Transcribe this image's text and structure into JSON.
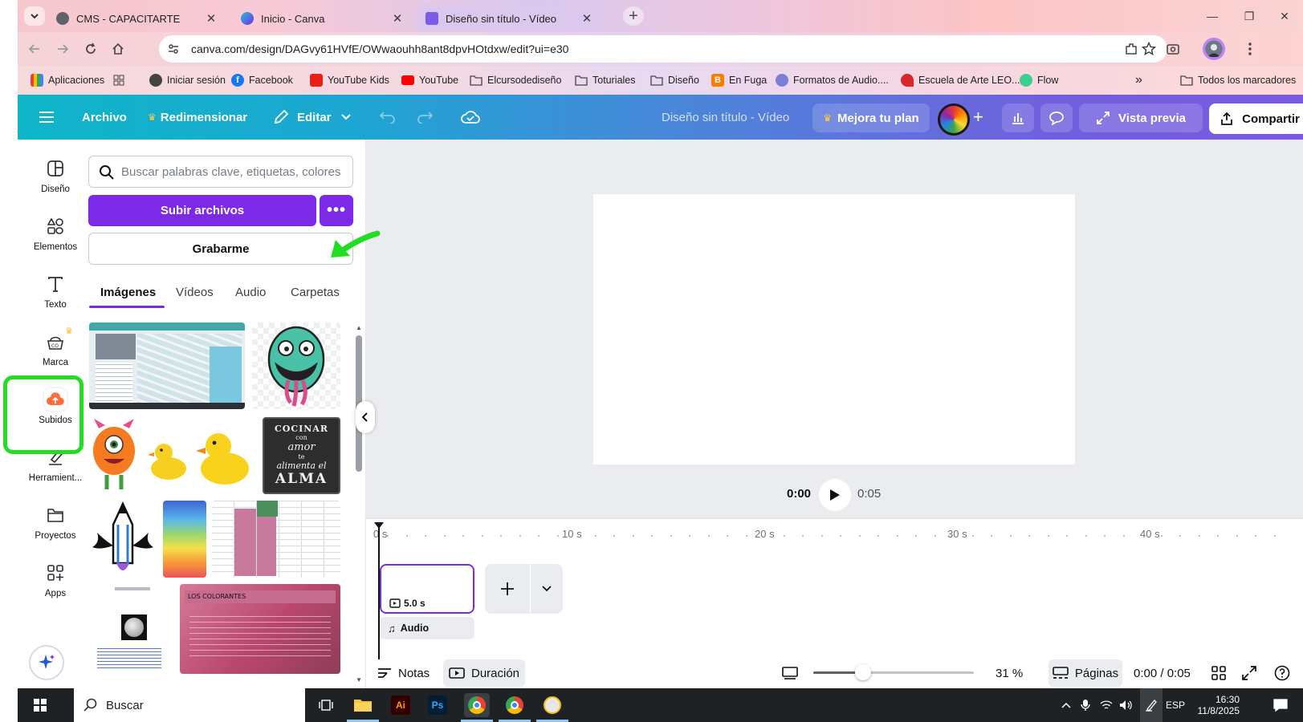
{
  "browser": {
    "tabs": [
      {
        "title": "CMS - CAPACITARTE",
        "close": "✕"
      },
      {
        "title": "Inicio - Canva",
        "close": "✕"
      },
      {
        "title": "Diseño sin título - Vídeo",
        "close": "✕"
      }
    ],
    "new_tab": "+",
    "url": "canva.com/design/DAGvy61HVfE/OWwaouhh8ant8dpvHOtdxw/edit?ui=e30",
    "bookmarks": [
      {
        "label": "Aplicaciones",
        "icon": "apps-grid-icon"
      },
      {
        "label": "",
        "icon": "grid-icon"
      },
      {
        "label": "Iniciar sesión",
        "icon": "globe-icon"
      },
      {
        "label": "Facebook",
        "icon": "facebook-icon"
      },
      {
        "label": "YouTube Kids",
        "icon": "youtube-kids-icon"
      },
      {
        "label": "YouTube",
        "icon": "youtube-icon"
      },
      {
        "label": "Elcursodediseño",
        "icon": "folder-icon"
      },
      {
        "label": "Toturiales",
        "icon": "folder-icon"
      },
      {
        "label": "Diseño",
        "icon": "folder-icon"
      },
      {
        "label": "En Fuga",
        "icon": "blogger-icon"
      },
      {
        "label": "Formatos de Audio....",
        "icon": "globe-icon"
      },
      {
        "label": "Escuela de Arte LEO...",
        "icon": "leo-icon"
      },
      {
        "label": "Flow",
        "icon": "flow-icon"
      }
    ],
    "bookmarks_overflow": "»",
    "all_bookmarks": "Todos los marcadores"
  },
  "canva": {
    "menu_file": "Archivo",
    "menu_resize": "Redimensionar",
    "menu_edit": "Editar",
    "doc_title": "Diseño sin título - Vídeo",
    "upgrade": "Mejora tu plan",
    "preview": "Vista previa",
    "share": "Compartir",
    "brand_color": "#7d2ae8"
  },
  "rail": [
    {
      "label": "Diseño",
      "icon": "layout-icon"
    },
    {
      "label": "Elementos",
      "icon": "elements-icon"
    },
    {
      "label": "Texto",
      "icon": "text-icon"
    },
    {
      "label": "Marca",
      "icon": "brand-icon"
    },
    {
      "label": "Subidos",
      "icon": "upload-cloud-icon"
    },
    {
      "label": "Herramient...",
      "icon": "draw-tool-icon"
    },
    {
      "label": "Proyectos",
      "icon": "folder-icon"
    },
    {
      "label": "Apps",
      "icon": "apps-icon"
    }
  ],
  "panel": {
    "search_placeholder": "Buscar palabras clave, etiquetas, colores",
    "upload_button": "Subir archivos",
    "upload_more": "•••",
    "record_button": "Grabarme",
    "tabs": [
      "Imágenes",
      "Vídeos",
      "Audio",
      "Carpetas"
    ],
    "thumb_text": {
      "chalk_line1": "COCINAR",
      "chalk_line2": "con",
      "chalk_line3": "amor",
      "chalk_line4": "te",
      "chalk_line5": "alimenta el",
      "chalk_line6": "ALMA",
      "colorantes_title": "LOS COLORANTES"
    }
  },
  "player": {
    "current": "0:00",
    "total": "0:05"
  },
  "timeline": {
    "ticks": [
      "0 s",
      "10 s",
      "20 s",
      "30 s",
      "40 s"
    ],
    "clip_duration": "5.0 s",
    "audio_label": "Audio"
  },
  "footer": {
    "notes": "Notas",
    "duration": "Duración",
    "zoom_percent": "31 %",
    "zoom_value": 31,
    "pages": "Páginas",
    "time": "0:00 / 0:05"
  },
  "taskbar": {
    "search": "Buscar",
    "lang": "ESP",
    "time": "16:30",
    "date": "11/8/2025"
  },
  "annotations": {
    "highlight_color": "#22dd22"
  }
}
